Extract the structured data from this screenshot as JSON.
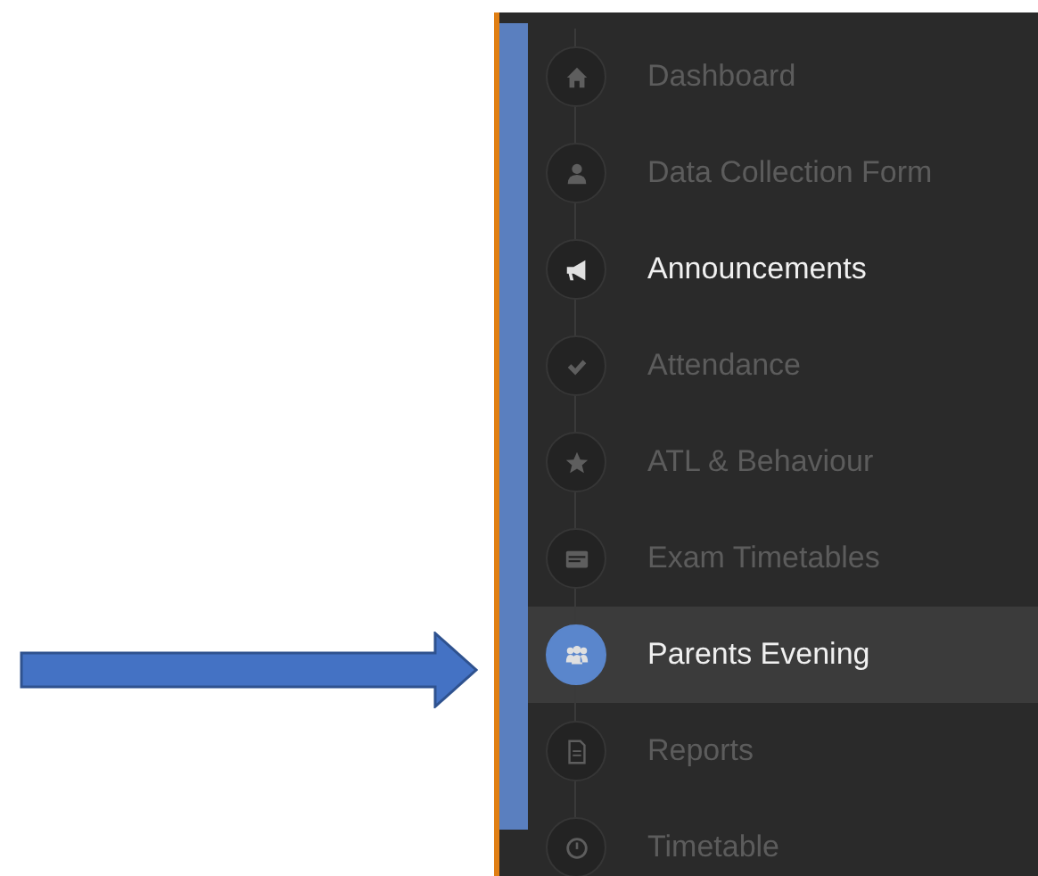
{
  "sidebar": {
    "items": [
      {
        "label": "Dashboard",
        "kind": "home",
        "selected": false,
        "highlighted": false
      },
      {
        "label": "Data Collection Form",
        "kind": "user",
        "selected": false,
        "highlighted": false
      },
      {
        "label": "Announcements",
        "kind": "megaphone",
        "selected": false,
        "highlighted": true
      },
      {
        "label": "Attendance",
        "kind": "check",
        "selected": false,
        "highlighted": false
      },
      {
        "label": "ATL & Behaviour",
        "kind": "star",
        "selected": false,
        "highlighted": false
      },
      {
        "label": "Exam Timetables",
        "kind": "card",
        "selected": false,
        "highlighted": false
      },
      {
        "label": "Parents Evening",
        "kind": "people",
        "selected": true,
        "highlighted": true
      },
      {
        "label": "Reports",
        "kind": "document",
        "selected": false,
        "highlighted": false
      },
      {
        "label": "Timetable",
        "kind": "clock",
        "selected": false,
        "highlighted": false
      }
    ]
  }
}
